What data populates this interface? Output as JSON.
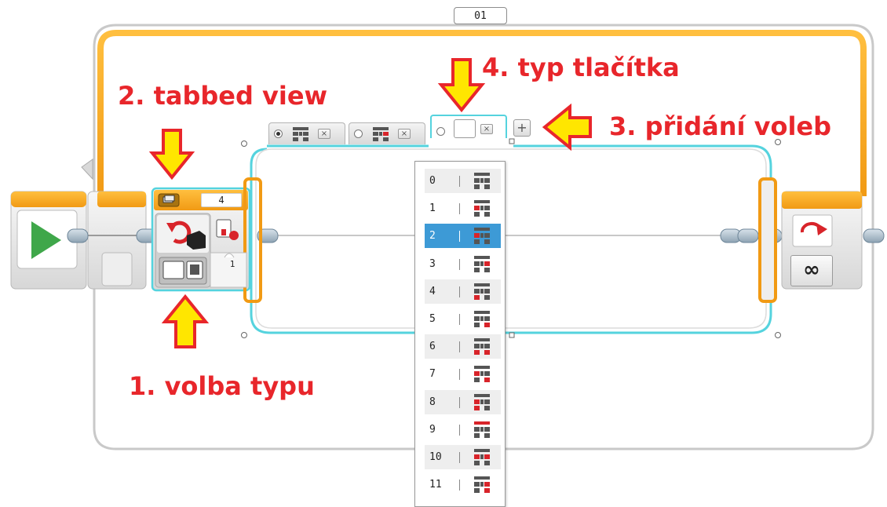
{
  "loop": {
    "name": "01",
    "count_mode_symbol": "∞"
  },
  "wait_block": {
    "value": "4",
    "port_number": "1"
  },
  "switch": {
    "tabs": [
      {
        "selected": true
      },
      {
        "selected": false
      },
      {
        "selected": false,
        "active": true
      }
    ],
    "close_glyph": "×",
    "add_glyph": "+"
  },
  "dropdown": {
    "selected_index": 2,
    "options": [
      "0",
      "1",
      "2",
      "3",
      "4",
      "5",
      "6",
      "7",
      "8",
      "9",
      "10",
      "11"
    ]
  },
  "annotations": {
    "type_choice": "1. volba typu",
    "tabbed_view": "2. tabbed view",
    "add_options": "3. přidání voleb",
    "button_type": "4. typ tlačítka"
  },
  "colors": {
    "annotation": "#e8262b",
    "arrow_fill": "#ffe600",
    "loop_frame": "#f4a43c",
    "switch_frame": "#55d3de",
    "selection": "#3d9ad6",
    "start_green": "#3fa74a"
  }
}
